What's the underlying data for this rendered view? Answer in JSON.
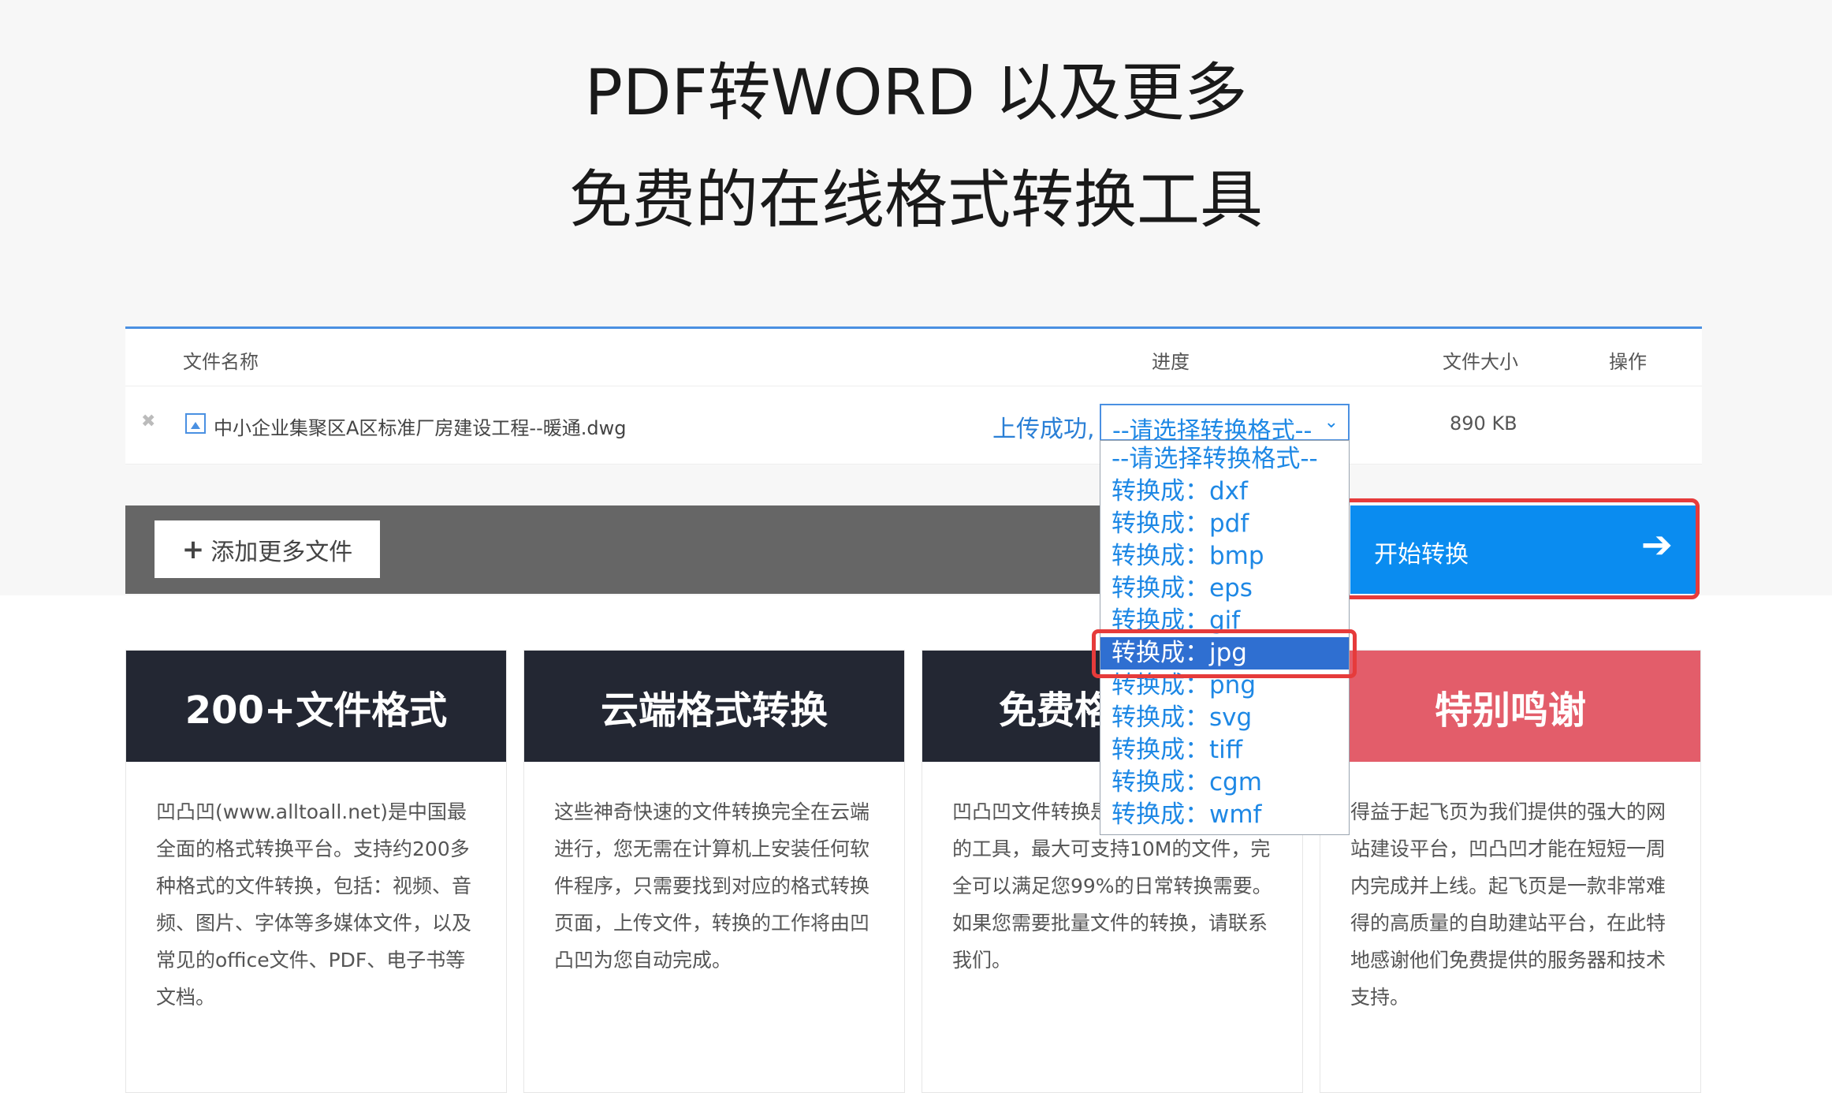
{
  "hero": {
    "title_line1": "PDF转WORD 以及更多",
    "title_line2": "免费的在线格式转换工具"
  },
  "table": {
    "headers": {
      "filename": "文件名称",
      "progress": "进度",
      "size": "文件大小",
      "action": "操作"
    },
    "file": {
      "name": "中小企业集聚区A区标准厂房建设工程--暖通.dwg",
      "status": "上传成功,",
      "selected_format": "--请选择转换格式--",
      "size": "890 KB",
      "remove_glyph": "✖"
    }
  },
  "actions": {
    "add_more": "添加更多文件",
    "start": "开始转换"
  },
  "format_options": [
    "--请选择转换格式--",
    "转换成：dxf",
    "转换成：pdf",
    "转换成：bmp",
    "转换成：eps",
    "转换成：gif",
    "转换成：jpg",
    "转换成：png",
    "转换成：svg",
    "转换成：tiff",
    "转换成：cgm",
    "转换成：wmf"
  ],
  "highlighted_option": "转换成：jpg",
  "cards": [
    {
      "title": "200+文件格式",
      "body": "凹凸凹(www.alltoall.net)是中国最全面的格式转换平台。支持约200多种格式的文件转换，包括：视频、音频、图片、字体等多媒体文件，以及常见的office文件、PDF、电子书等文档。"
    },
    {
      "title": "云端格式转换",
      "body": "这些神奇快速的文件转换完全在云端进行，您无需在计算机上安装任何软件程序，只需要找到对应的格式转换页面，上传文件，转换的工作将由凹凸凹为您自动完成。"
    },
    {
      "title": "免费格式转换",
      "body": "凹凸凹文件转换是一款可以免费使用的工具，最大可支持10M的文件，完全可以满足您99%的日常转换需要。如果您需要批量文件的转换，请联系我们。"
    },
    {
      "title": "特别鸣谢",
      "body": "得益于起飞页为我们提供的强大的网站建设平台，凹凸凹才能在短短一周内完成并上线。起飞页是一款非常难得的高质量的自助建站平台，在此特地感谢他们免费提供的服务器和技术支持。"
    }
  ],
  "colors": {
    "accent": "#0a8cf0",
    "link_blue": "#1e88e5",
    "card_dark": "#232733",
    "card_pink": "#e35d6a",
    "highlight_red": "#e63b3b",
    "action_bar": "#666666"
  }
}
